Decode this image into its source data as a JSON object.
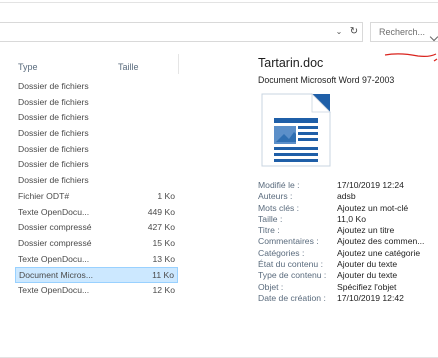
{
  "toolbar": {
    "search_placeholder": "Recherch...",
    "refresh_glyph": "↻",
    "dropdown_glyph": "⌄"
  },
  "columns": {
    "type": "Type",
    "size": "Taille"
  },
  "files": [
    {
      "type": "Dossier de fichiers",
      "size": ""
    },
    {
      "type": "Dossier de fichiers",
      "size": ""
    },
    {
      "type": "Dossier de fichiers",
      "size": ""
    },
    {
      "type": "Dossier de fichiers",
      "size": ""
    },
    {
      "type": "Dossier de fichiers",
      "size": ""
    },
    {
      "type": "Dossier de fichiers",
      "size": ""
    },
    {
      "type": "Dossier de fichiers",
      "size": ""
    },
    {
      "type": "Fichier ODT#",
      "size": "1 Ko"
    },
    {
      "type": "Texte OpenDocu...",
      "size": "449 Ko"
    },
    {
      "type": "Dossier compressé",
      "size": "427 Ko"
    },
    {
      "type": "Dossier compressé",
      "size": "15 Ko"
    },
    {
      "type": "Texte OpenDocu...",
      "size": "13 Ko"
    },
    {
      "type": "Document Micros...",
      "size": "11 Ko",
      "selected": true
    },
    {
      "type": "Texte OpenDocu...",
      "size": "12 Ko"
    }
  ],
  "preview": {
    "filename": "Tartarin.doc",
    "filetype": "Document Microsoft Word 97-2003",
    "properties": [
      {
        "key": "Modifié le :",
        "value": "17/10/2019 12:24"
      },
      {
        "key": "Auteurs :",
        "value": "adsb"
      },
      {
        "key": "Mots clés :",
        "value": "Ajoutez un mot-clé"
      },
      {
        "key": "Taille :",
        "value": "11,0 Ko"
      },
      {
        "key": "Titre :",
        "value": "Ajoutez un titre"
      },
      {
        "key": "Commentaires :",
        "value": "Ajoutez des commen..."
      },
      {
        "key": "Catégories :",
        "value": "Ajoutez une catégorie"
      },
      {
        "key": "État du contenu :",
        "value": "Ajouter du texte"
      },
      {
        "key": "Type de contenu :",
        "value": "Ajouter du texte"
      },
      {
        "key": "Objet :",
        "value": "Spécifiez l'objet"
      },
      {
        "key": "Date de création :",
        "value": "17/10/2019 12:42"
      }
    ]
  },
  "colors": {
    "selection_bg": "#cce8ff",
    "selection_border": "#99d1ff",
    "doc_icon_blue": "#1f5fa8",
    "annotation_red": "#d9231d"
  }
}
